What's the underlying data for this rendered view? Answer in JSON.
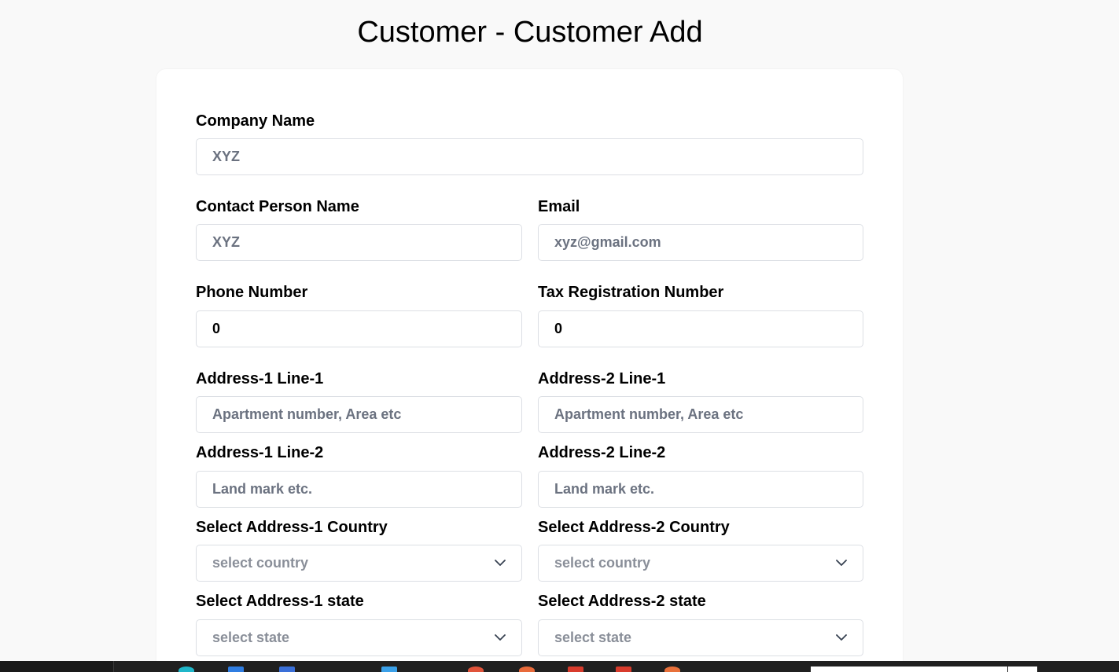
{
  "page": {
    "title": "Customer - Customer Add"
  },
  "form": {
    "company_name": {
      "label": "Company Name",
      "placeholder": "XYZ"
    },
    "contact_person_name": {
      "label": "Contact Person Name",
      "placeholder": "XYZ"
    },
    "email": {
      "label": "Email",
      "placeholder": "xyz@gmail.com"
    },
    "phone_number": {
      "label": "Phone Number",
      "value": "0"
    },
    "tax_registration_number": {
      "label": "Tax Registration Number",
      "value": "0"
    },
    "address1_line1": {
      "label": "Address-1 Line-1",
      "placeholder": "Apartment number, Area etc"
    },
    "address2_line1": {
      "label": "Address-2 Line-1",
      "placeholder": "Apartment number, Area etc"
    },
    "address1_line2": {
      "label": "Address-1 Line-2",
      "placeholder": "Land mark etc."
    },
    "address2_line2": {
      "label": "Address-2 Line-2",
      "placeholder": "Land mark etc."
    },
    "address1_country": {
      "label": "Select Address-1 Country",
      "selected": "select country"
    },
    "address2_country": {
      "label": "Select Address-2 Country",
      "selected": "select country"
    },
    "address1_state": {
      "label": "Select Address-1 state",
      "selected": "select state"
    },
    "address2_state": {
      "label": "Select Address-2 state",
      "selected": "select state"
    }
  },
  "icons": {
    "select_chevron": "chevron-down-icon"
  },
  "colors": {
    "page_background": "#f9f9f9",
    "card_background": "#ffffff",
    "input_border": "#dcdfe4",
    "placeholder_text": "#6b7280",
    "taskbar": "#202020"
  }
}
